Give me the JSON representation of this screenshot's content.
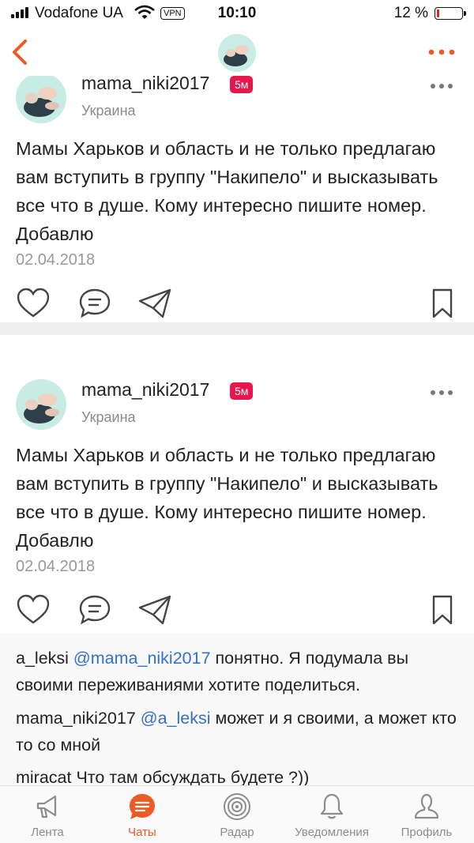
{
  "status_bar": {
    "carrier": "Vodafone UA",
    "vpn": "VPN",
    "time": "10:10",
    "battery_percent": "12 %",
    "battery_level": 0.12
  },
  "nav": {
    "back_icon": "chevron-left-icon",
    "more_icon": "more-dots-icon",
    "accent": "#ee5a24"
  },
  "posts": [
    {
      "author": "mama_niki2017",
      "badge": "5м",
      "country": "Украина",
      "text": "Мамы Харьков и область и не только предлагаю вам вступить в группу \"Накипело\" и высказывать все что в душе. Кому интересно пишите номер. Добавлю",
      "date": "02.04.2018"
    },
    {
      "author": "mama_niki2017",
      "badge": "5м",
      "country": "Украина",
      "text": "Мамы Харьков и область и не только предлагаю вам вступить в группу \"Накипело\" и высказывать все что в душе. Кому интересно пишите номер. Добавлю",
      "date": "02.04.2018"
    }
  ],
  "comments": [
    {
      "author": "a_leksi",
      "mention": "@mama_niki2017",
      "text": "понятно. Я подумала вы своими переживаниями хотите поделиться."
    },
    {
      "author": "mama_niki2017",
      "mention": "@a_leksi",
      "text": "может и я своими, а может кто то со мной"
    },
    {
      "author": "miracat",
      "mention": "",
      "text": "Что там обсуждать будете ?))"
    }
  ],
  "tabs": [
    {
      "label": "Лента",
      "icon": "megaphone-icon",
      "active": false
    },
    {
      "label": "Чаты",
      "icon": "chat-icon",
      "active": true
    },
    {
      "label": "Радар",
      "icon": "radar-icon",
      "active": false
    },
    {
      "label": "Уведомления",
      "icon": "bell-icon",
      "active": false
    },
    {
      "label": "Профиль",
      "icon": "profile-icon",
      "active": false
    }
  ],
  "colors": {
    "accent": "#ee5a24",
    "badge": "#e8164d",
    "mention": "#3570c8",
    "battery_low": "#e0261a"
  }
}
